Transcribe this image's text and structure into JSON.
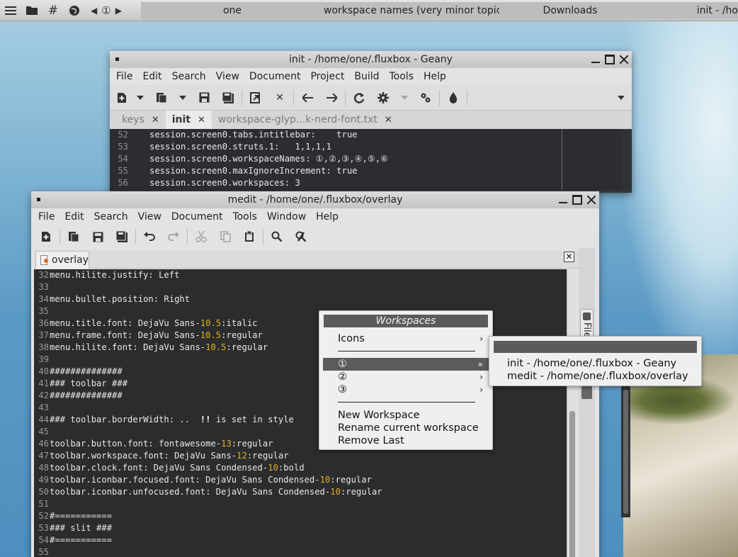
{
  "taskbar": {
    "workspace_current": "①",
    "tasks": [
      "one",
      "workspace names (very minor topic) - P",
      "Downloads",
      "init - /ho"
    ]
  },
  "geany": {
    "title": "init - /home/one/.fluxbox - Geany",
    "menu": [
      "File",
      "Edit",
      "Search",
      "View",
      "Document",
      "Project",
      "Build",
      "Tools",
      "Help"
    ],
    "tabs": [
      {
        "label": "keys",
        "active": false
      },
      {
        "label": "init",
        "active": true
      },
      {
        "label": "workspace-glyp...k-nerd-font.txt",
        "active": false
      }
    ],
    "lines": [
      {
        "n": "52",
        "text": "session.screen0.tabs.intitlebar:    true"
      },
      {
        "n": "53",
        "text": "session.screen0.struts.1:   1,1,1,1"
      },
      {
        "n": "54",
        "text": "session.screen0.workspaceNames: ①,②,③,④,⑤,⑥"
      },
      {
        "n": "55",
        "text": "session.screen0.maxIgnoreIncrement: true"
      },
      {
        "n": "56",
        "text": "session.screen0.workspaces: 3"
      }
    ]
  },
  "medit": {
    "title": "medit - /home/one/.fluxbox/overlay",
    "menu": [
      "File",
      "Edit",
      "Search",
      "View",
      "Document",
      "Tools",
      "Window",
      "Help"
    ],
    "tab": "overlay",
    "side_panel_label": "File Selector",
    "lines": [
      {
        "n": "32",
        "parts": [
          [
            "t",
            "menu.hilite.justify: Left"
          ]
        ]
      },
      {
        "n": "33",
        "parts": []
      },
      {
        "n": "34",
        "parts": [
          [
            "t",
            "menu.bullet.position: Right"
          ]
        ]
      },
      {
        "n": "35",
        "parts": []
      },
      {
        "n": "36",
        "parts": [
          [
            "t",
            "menu.title.font: DejaVu Sans-"
          ],
          [
            "n",
            "10.5"
          ],
          [
            "t",
            ":italic"
          ]
        ]
      },
      {
        "n": "37",
        "parts": [
          [
            "t",
            "menu.frame.font: DejaVu Sans-"
          ],
          [
            "n",
            "10.5"
          ],
          [
            "t",
            ":regular"
          ]
        ]
      },
      {
        "n": "38",
        "parts": [
          [
            "t",
            "menu.hilite.font: DejaVu Sans-"
          ],
          [
            "n",
            "10.5"
          ],
          [
            "t",
            ":regular"
          ]
        ]
      },
      {
        "n": "39",
        "parts": []
      },
      {
        "n": "40",
        "parts": [
          [
            "t",
            "##############"
          ]
        ]
      },
      {
        "n": "41",
        "parts": [
          [
            "t",
            "### toolbar ###"
          ]
        ]
      },
      {
        "n": "42",
        "parts": [
          [
            "t",
            "##############"
          ]
        ]
      },
      {
        "n": "43",
        "parts": []
      },
      {
        "n": "44",
        "parts": [
          [
            "t",
            "### toolbar.borderWidth: ..  "
          ],
          [
            "b",
            "!!"
          ],
          [
            "t",
            " is set in style"
          ]
        ]
      },
      {
        "n": "45",
        "parts": []
      },
      {
        "n": "46",
        "parts": [
          [
            "t",
            "toolbar.button.font: fontawesome-"
          ],
          [
            "n",
            "13"
          ],
          [
            "t",
            ":regular"
          ]
        ]
      },
      {
        "n": "47",
        "parts": [
          [
            "t",
            "toolbar.workspace.font: DejaVu Sans-"
          ],
          [
            "n",
            "12"
          ],
          [
            "t",
            ":regular"
          ]
        ]
      },
      {
        "n": "48",
        "parts": [
          [
            "t",
            "toolbar.clock.font: DejaVu Sans Condensed-"
          ],
          [
            "n",
            "10"
          ],
          [
            "t",
            ":bold"
          ]
        ]
      },
      {
        "n": "49",
        "parts": [
          [
            "t",
            "toolbar.iconbar.focused.font: DejaVu Sans Condensed-"
          ],
          [
            "n",
            "10"
          ],
          [
            "t",
            ":regular"
          ]
        ]
      },
      {
        "n": "50",
        "parts": [
          [
            "t",
            "toolbar.iconbar.unfocused.font: DejaVu Sans Condensed-"
          ],
          [
            "n",
            "10"
          ],
          [
            "t",
            ":regular"
          ]
        ]
      },
      {
        "n": "51",
        "parts": []
      },
      {
        "n": "52",
        "parts": [
          [
            "t",
            "#==========="
          ]
        ]
      },
      {
        "n": "53",
        "parts": [
          [
            "t",
            "### slit ###"
          ]
        ]
      },
      {
        "n": "54",
        "parts": [
          [
            "t",
            "#==========="
          ]
        ]
      },
      {
        "n": "55",
        "parts": []
      }
    ]
  },
  "workspace_menu": {
    "title": "Workspaces",
    "icons_label": "Icons",
    "workspaces": [
      "①",
      "②",
      "③"
    ],
    "selected_index": 0,
    "actions": [
      "New Workspace",
      "Rename current workspace",
      "Remove Last"
    ]
  },
  "workspace_submenu": {
    "items": [
      "init - /home/one/.fluxbox - Geany",
      "medit - /home/one/.fluxbox/overlay"
    ]
  },
  "colors": {
    "editor_bg": "#2b2d30",
    "number_highlight": "#e0b020",
    "menu_highlight": "#5b5b5b"
  }
}
